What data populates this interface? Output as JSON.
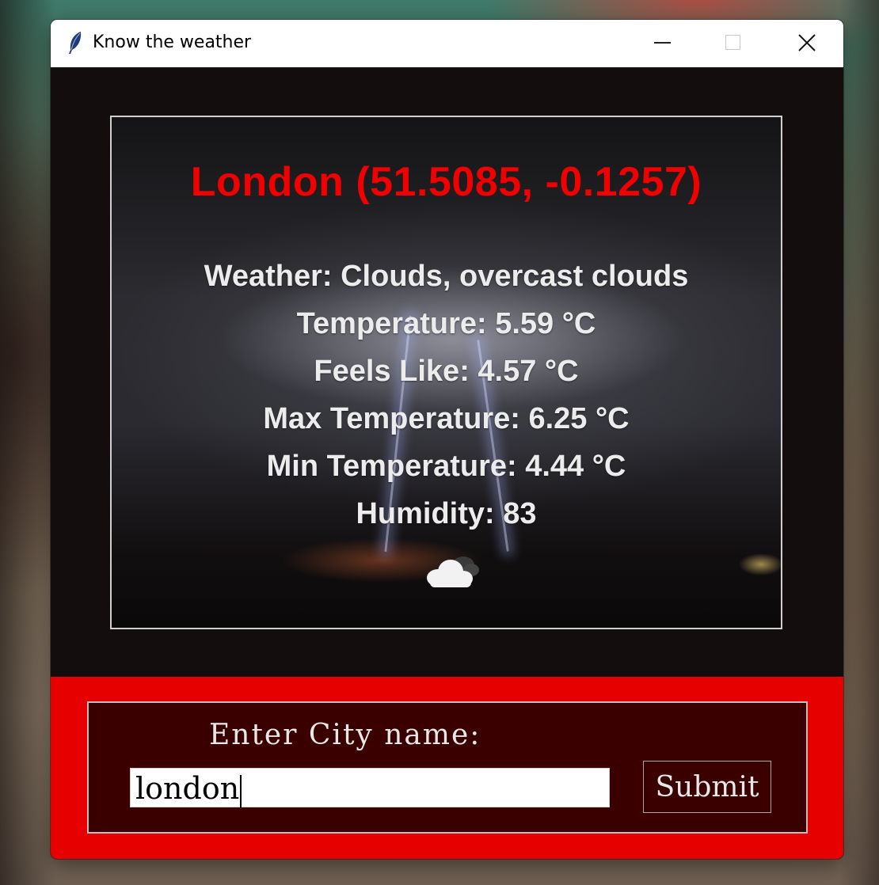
{
  "window": {
    "title": "Know the weather"
  },
  "weather": {
    "city_header": "London (51.5085, -0.1257)",
    "lines": [
      "Weather:  Clouds, overcast clouds",
      "Temperature:  5.59 °C",
      "Feels Like:  4.57 °C",
      "Max Temperature:  6.25 °C",
      "Min Temperature:  4.44 °C",
      "Humidity:  83"
    ],
    "icon": "cloud-icon"
  },
  "form": {
    "label": "Enter City name:",
    "city_value": "london",
    "submit_label": "Submit"
  },
  "colors": {
    "title_red": "#f00000",
    "band_red": "#e60000",
    "box_dark_red": "#3a0000",
    "window_bg": "#130d0e"
  }
}
